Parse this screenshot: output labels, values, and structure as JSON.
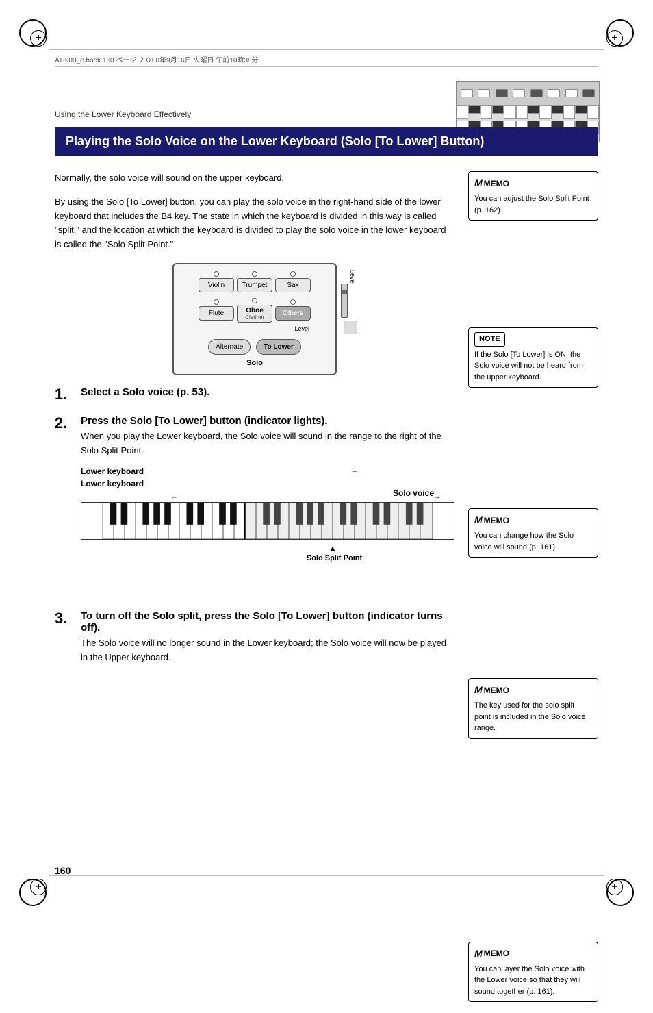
{
  "page": {
    "number": "160",
    "header_text": "AT-900_e.book  160 ページ  ２０08年9月16日  火曜日  午前10時38分"
  },
  "breadcrumb": {
    "text": "Using the Lower Keyboard Effectively"
  },
  "title": {
    "text": "Playing the Solo Voice on the Lower Keyboard (Solo [To Lower] Button)"
  },
  "intro": {
    "line1": "Normally, the solo voice will sound on the upper keyboard.",
    "para": "By using the Solo [To Lower] button, you can play the solo voice in the right-hand side of the lower keyboard that includes the B4 key. The state in which the keyboard is divided in this way is called \"split,\" and the location at which the keyboard is divided to play the solo voice in the lower keyboard is called the \"Solo Split Point.\""
  },
  "panel": {
    "buttons_row1": [
      "Violin",
      "Trumpet",
      "Sax"
    ],
    "buttons_row2_left": "Flute",
    "buttons_row2_mid_top": "Oboe",
    "buttons_row2_mid_sub": "Clarinet",
    "buttons_row2_right": "Others",
    "label_level": "Level",
    "label_solo": "Solo",
    "btn_alternate": "Alternate",
    "btn_to_lower": "To Lower"
  },
  "steps": [
    {
      "number": "1",
      "title": "Select a Solo voice (p. 53).",
      "description": ""
    },
    {
      "number": "2",
      "title": "Press the Solo [To Lower] button (indicator lights).",
      "description": "When you play the Lower keyboard, the Solo voice will sound in the range to the right of the Solo Split Point."
    },
    {
      "number": "3",
      "title": "To turn off the Solo split, press the Solo [To Lower] button (indicator turns off).",
      "description": "The Solo voice will no longer sound in the Lower keyboard; the Solo voice will now be played in the Upper keyboard."
    }
  ],
  "keyboard_diagram": {
    "label_left": "Lower keyboard",
    "label_right": "Solo voice",
    "split_label": "Solo Split Point"
  },
  "sidebar": {
    "memo1": {
      "title": "MEMO",
      "text": "You can adjust the Solo Split Point (p. 162)."
    },
    "note1": {
      "title": "NOTE",
      "text": "If the Solo [To Lower] is ON, the Solo voice will not be heard from the upper keyboard."
    },
    "memo2": {
      "title": "MEMO",
      "text": "You can change how the Solo voice will sound (p. 161)."
    },
    "memo3": {
      "title": "MEMO",
      "text": "The key used for the solo split point is included in the Solo voice range."
    },
    "memo4": {
      "title": "MEMO",
      "text": "You can layer the Solo voice with the Lower voice so that they will sound together (p. 161)."
    }
  }
}
